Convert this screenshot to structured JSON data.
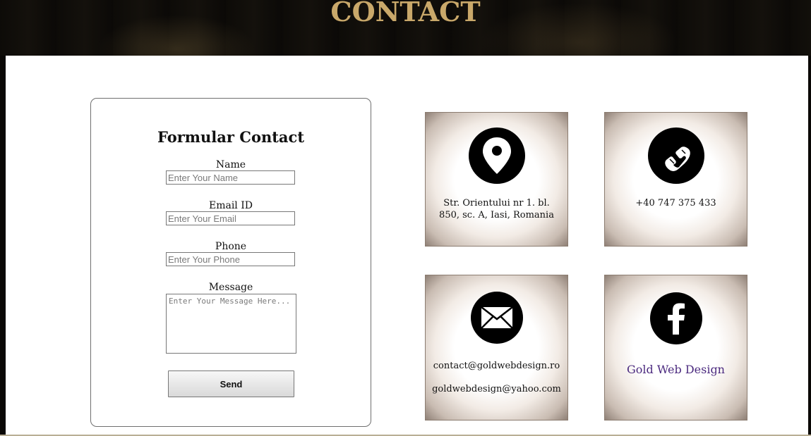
{
  "header": {
    "title": "CONTACT"
  },
  "form": {
    "title": "Formular Contact",
    "fields": [
      {
        "label": "Name",
        "placeholder": "Enter Your Name"
      },
      {
        "label": "Email ID",
        "placeholder": "Enter Your Email"
      },
      {
        "label": "Phone",
        "placeholder": "Enter Your Phone"
      }
    ],
    "message": {
      "label": "Message",
      "placeholder": "Enter Your Message Here..."
    },
    "send_label": "Send"
  },
  "tiles": {
    "address": {
      "icon": "location-pin-icon",
      "line1": "Str. Orientului nr 1. bl.",
      "line2": "850, sc. A, Iasi, Romania"
    },
    "phone": {
      "icon": "phone-icon",
      "text": "+40 747 375 433"
    },
    "email": {
      "icon": "envelope-icon",
      "line1": "contact@goldwebdesign.ro",
      "line2": "goldwebdesign@yahoo.com"
    },
    "facebook": {
      "icon": "facebook-icon",
      "link": "Gold Web Design"
    }
  },
  "colors": {
    "title_gold": "#c9a86a",
    "link_purple": "#4b2a7f"
  }
}
